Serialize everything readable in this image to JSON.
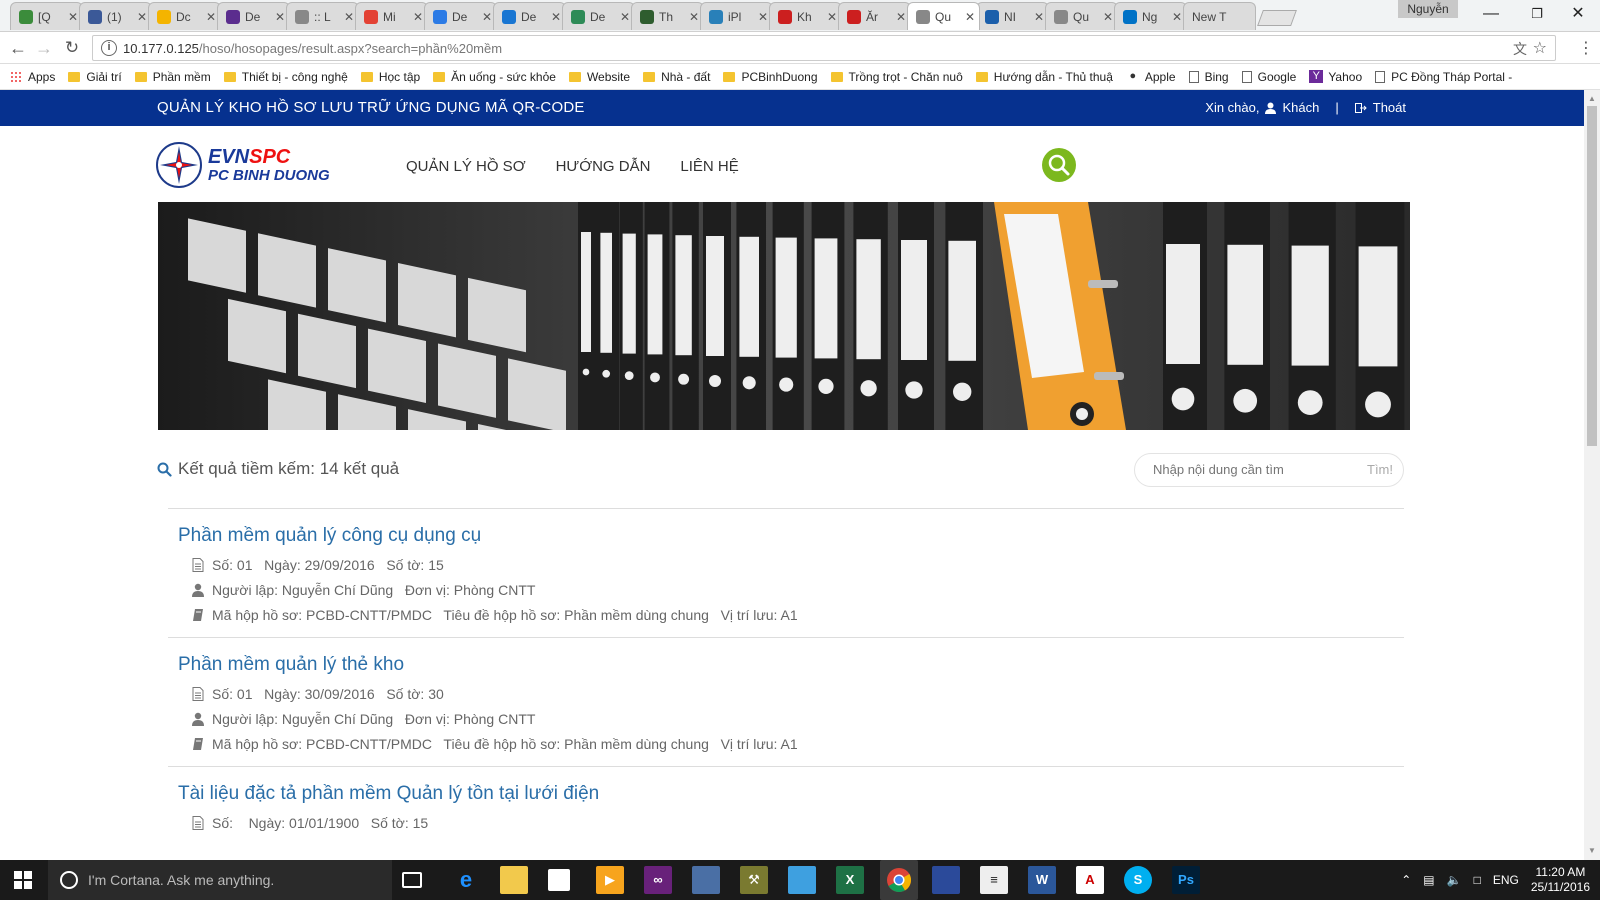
{
  "browser": {
    "tabs": [
      {
        "title": "[Q",
        "icon": "ticket-icon",
        "color": "#3b8c3b"
      },
      {
        "title": "(1)",
        "icon": "facebook-icon",
        "color": "#3b5998"
      },
      {
        "title": "Dc",
        "icon": "drive-icon",
        "color": "#f4b400"
      },
      {
        "title": "De",
        "icon": "document-icon",
        "color": "#5b2d8e"
      },
      {
        "title": ":: L",
        "icon": "page-icon",
        "color": "#888888"
      },
      {
        "title": "Mi",
        "icon": "flower-icon",
        "color": "#e34234"
      },
      {
        "title": "De",
        "icon": "b-icon",
        "color": "#2c7be5"
      },
      {
        "title": "De",
        "icon": "wave-icon",
        "color": "#1976d2"
      },
      {
        "title": "De",
        "icon": "tsc-icon",
        "color": "#2e8b57"
      },
      {
        "title": "Th",
        "icon": "globe-icon",
        "color": "#2f5d2f"
      },
      {
        "title": "iPl",
        "icon": "z-icon",
        "color": "#2980b9"
      },
      {
        "title": "Kh",
        "icon": "pdf-icon",
        "color": "#cc1f1f"
      },
      {
        "title": "Ăr",
        "icon": "pdf-icon",
        "color": "#cc1f1f"
      },
      {
        "title": "Qu",
        "icon": "page-icon",
        "color": "#888888",
        "active": true
      },
      {
        "title": "NI",
        "icon": "house-icon",
        "color": "#1b5fab"
      },
      {
        "title": "Qu",
        "icon": "page-icon",
        "color": "#888888"
      },
      {
        "title": "Ng",
        "icon": "outlook-icon",
        "color": "#0072c6"
      },
      {
        "title": "New T",
        "icon": "",
        "color": "#ffffff"
      }
    ],
    "profile_name": "Nguyễn",
    "url_host": "10.177.0.125",
    "url_path": "/hoso/hosopages/result.aspx?search=phần%20mềm",
    "bookmarks": [
      {
        "label": "Apps",
        "type": "apps"
      },
      {
        "label": "Giải trí",
        "type": "folder"
      },
      {
        "label": "Phần mềm",
        "type": "folder"
      },
      {
        "label": "Thiết bị - công nghệ",
        "type": "folder"
      },
      {
        "label": "Học tập",
        "type": "folder"
      },
      {
        "label": "Ăn uống - sức khỏe",
        "type": "folder"
      },
      {
        "label": "Website",
        "type": "folder"
      },
      {
        "label": "Nhà - đất",
        "type": "folder"
      },
      {
        "label": "PCBinhDuong",
        "type": "folder"
      },
      {
        "label": "Trồng trọt - Chăn nuô",
        "type": "folder"
      },
      {
        "label": "Hướng dẫn - Thủ thuậ",
        "type": "folder"
      },
      {
        "label": "Apple",
        "type": "apple"
      },
      {
        "label": "Bing",
        "type": "page"
      },
      {
        "label": "Google",
        "type": "page"
      },
      {
        "label": "Yahoo",
        "type": "yahoo"
      },
      {
        "label": "PC Đồng Tháp Portal -",
        "type": "page"
      }
    ]
  },
  "site": {
    "top_title": "QUẢN LÝ KHO HỒ SƠ LƯU TRỮ ỨNG DỤNG MÃ QR-CODE",
    "greeting": "Xin chào,",
    "user": "Khách",
    "separator": "|",
    "logout": "Thoát",
    "logo_line1_a": "EVN",
    "logo_line1_b": "SPC",
    "logo_line2": "PC BINH DUONG",
    "menu": [
      "QUẢN LÝ HỒ SƠ",
      "HƯỚNG DẪN",
      "LIÊN HỆ"
    ],
    "accent_color": "#7cb81e",
    "nav_color": "#06318f"
  },
  "results": {
    "heading": "Kết quả tiềm kếm: 14 kết quả",
    "search_placeholder": "Nhập nội dung cần tìm",
    "search_button": "Tìm!",
    "items": [
      {
        "title": "Phần mềm quản lý công cụ dụng cụ",
        "line1": "Số: 01   Ngày: 29/09/2016   Số tờ: 15",
        "line2": "Người lập: Nguyễn Chí Dũng   Đơn vị: Phòng CNTT",
        "line3": "Mã hộp hồ sơ: PCBD-CNTT/PMDC   Tiêu đề hộp hồ sơ: Phần mềm dùng chung   Vị trí lưu: A1"
      },
      {
        "title": "Phần mềm quản lý thẻ kho",
        "line1": "Số: 01   Ngày: 30/09/2016   Số tờ: 30",
        "line2": "Người lập: Nguyễn Chí Dũng   Đơn vị: Phòng CNTT",
        "line3": "Mã hộp hồ sơ: PCBD-CNTT/PMDC   Tiêu đề hộp hồ sơ: Phần mềm dùng chung   Vị trí lưu: A1"
      },
      {
        "title": "Tài liệu đặc tả phần mềm Quản lý tồn tại lưới điện",
        "line1": "Số:    Ngày: 01/01/1900   Số tờ: 15",
        "line2": "",
        "line3": ""
      }
    ]
  },
  "taskbar": {
    "search_placeholder": "I'm Cortana. Ask me anything.",
    "language": "ENG",
    "time": "11:20 AM",
    "date": "25/11/2016"
  }
}
